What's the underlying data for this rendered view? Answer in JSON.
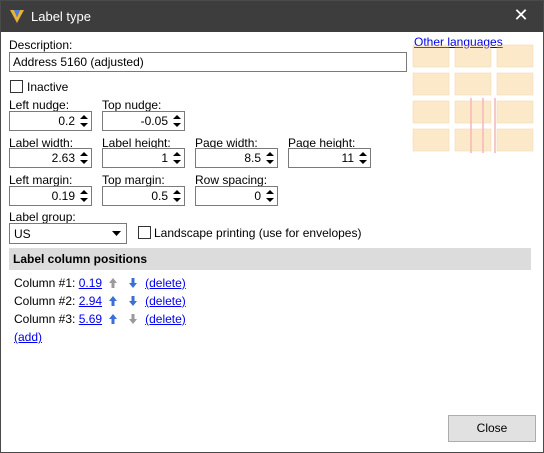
{
  "window": {
    "title": "Label type",
    "close_glyph": "✕"
  },
  "form": {
    "description_label": "Description:",
    "description_value": "Address 5160 (adjusted)",
    "other_languages": "Other languages",
    "inactive_label": "Inactive",
    "inactive_checked": false,
    "left_nudge_label": "Left nudge:",
    "left_nudge_value": "0.2",
    "top_nudge_label": "Top nudge:",
    "top_nudge_value": "-0.05",
    "label_width_label": "Label width:",
    "label_width_value": "2.63",
    "label_height_label": "Label height:",
    "label_height_value": "1",
    "page_width_label": "Page width:",
    "page_width_value": "8.5",
    "page_height_label": "Page height:",
    "page_height_value": "11",
    "left_margin_label": "Left margin:",
    "left_margin_value": "0.19",
    "top_margin_label": "Top margin:",
    "top_margin_value": "0.5",
    "row_spacing_label": "Row spacing:",
    "row_spacing_value": "0",
    "label_group_label": "Label group:",
    "label_group_value": "US",
    "landscape_label": "Landscape printing (use for envelopes)",
    "landscape_checked": false
  },
  "columns_section": {
    "header": "Label column positions",
    "columns": [
      {
        "label": "Column #1:",
        "value": "0.19",
        "delete": "(delete)"
      },
      {
        "label": "Column #2:",
        "value": "2.94",
        "delete": "(delete)"
      },
      {
        "label": "Column #3:",
        "value": "5.69",
        "delete": "(delete)"
      }
    ],
    "add": "(add)"
  },
  "footer": {
    "close_label": "Close"
  },
  "colors": {
    "titlebar": "#3d3d3d",
    "link": "#0000ee",
    "section_header": "#dcdcdc",
    "arrow_blue": "#3a6fd8"
  }
}
